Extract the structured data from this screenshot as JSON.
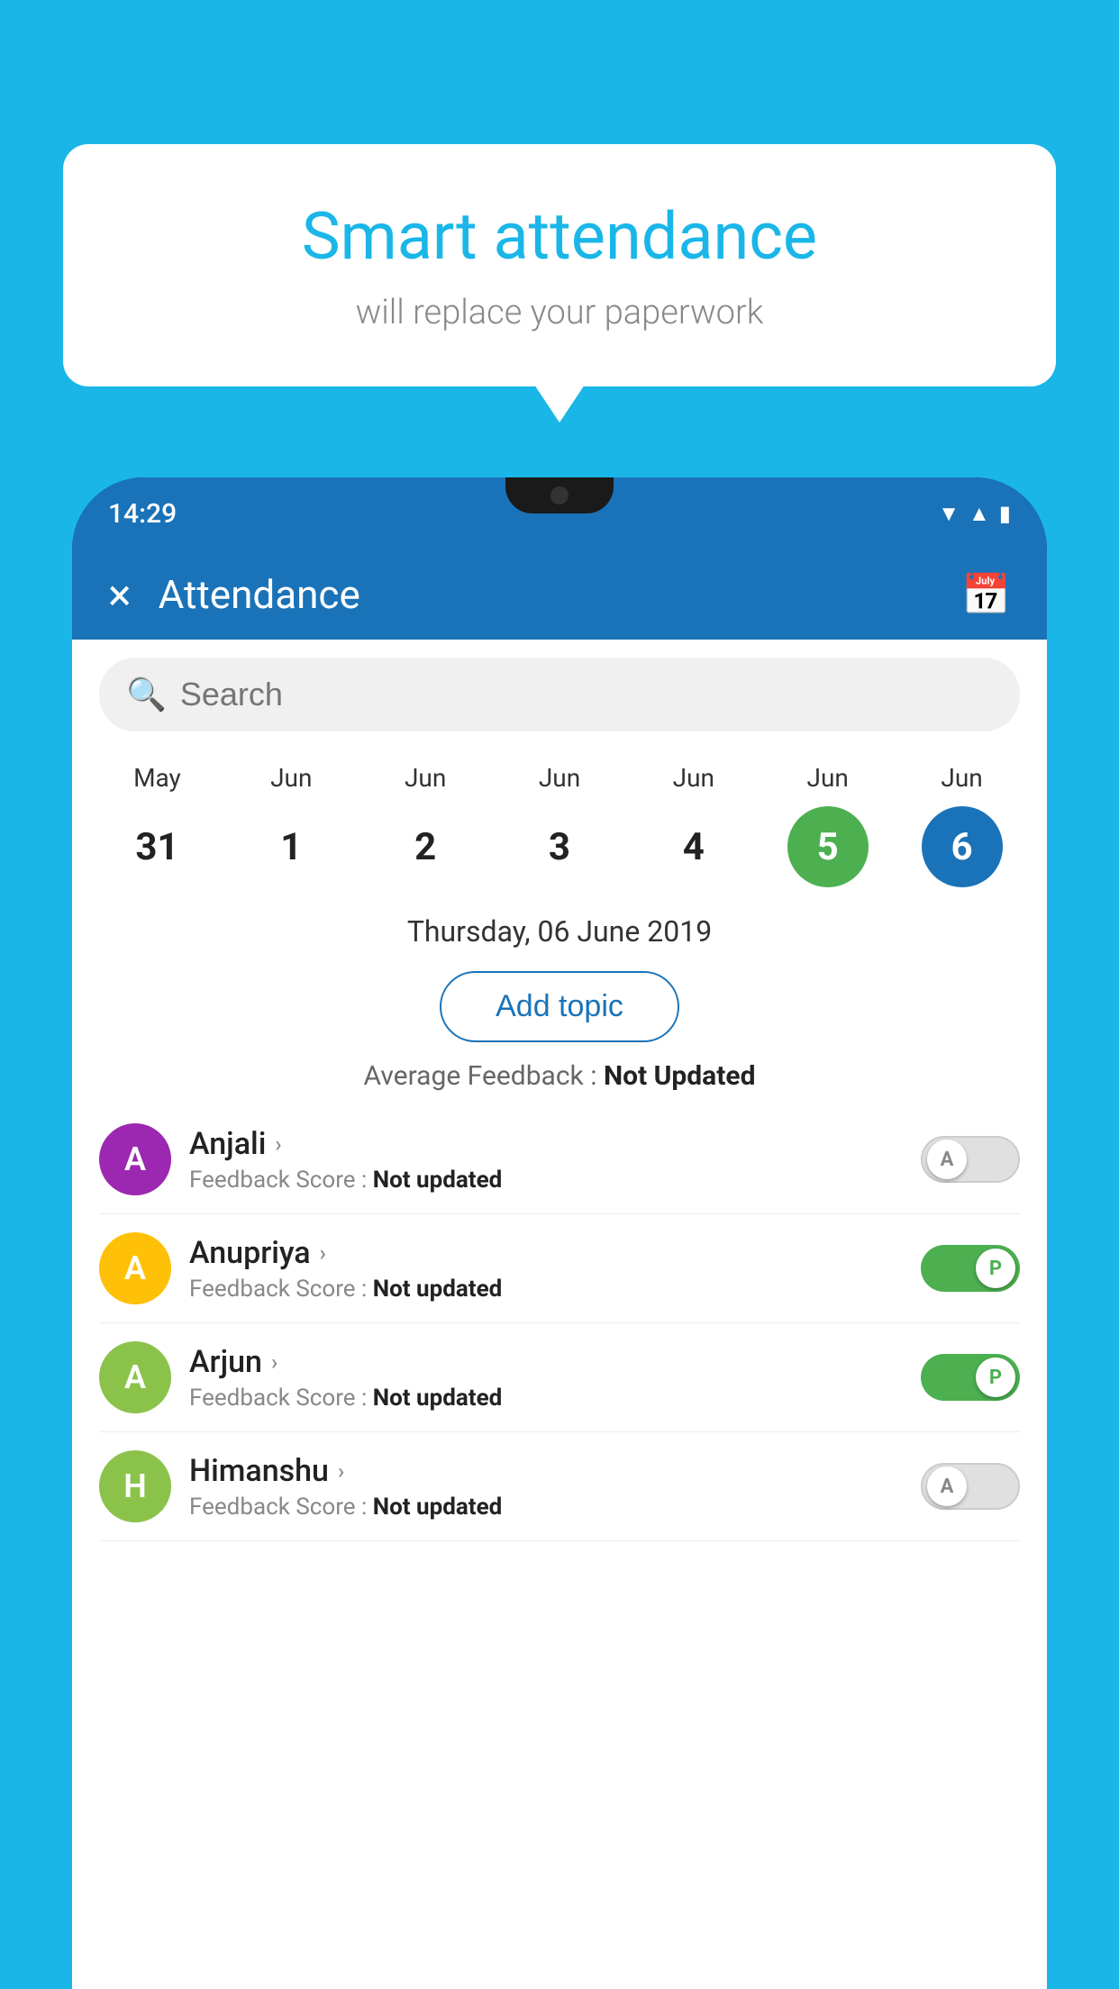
{
  "background_color": "#1ab6e8",
  "speech_bubble": {
    "title": "Smart attendance",
    "subtitle": "will replace your paperwork"
  },
  "phone": {
    "status_bar": {
      "time": "14:29"
    },
    "app_bar": {
      "title": "Attendance",
      "close_label": "×",
      "calendar_label": "📅"
    },
    "search": {
      "placeholder": "Search"
    },
    "dates": [
      {
        "month": "May",
        "day": "31"
      },
      {
        "month": "Jun",
        "day": "1"
      },
      {
        "month": "Jun",
        "day": "2"
      },
      {
        "month": "Jun",
        "day": "3"
      },
      {
        "month": "Jun",
        "day": "4"
      },
      {
        "month": "Jun",
        "day": "5",
        "state": "today"
      },
      {
        "month": "Jun",
        "day": "6",
        "state": "selected"
      }
    ],
    "selected_date_label": "Thursday, 06 June 2019",
    "add_topic_label": "Add topic",
    "avg_feedback_label": "Average Feedback :",
    "avg_feedback_value": "Not Updated",
    "students": [
      {
        "name": "Anjali",
        "avatar_letter": "A",
        "avatar_color": "#9c27b0",
        "score_label": "Feedback Score :",
        "score_value": "Not updated",
        "attendance": "absent",
        "toggle_letter": "A"
      },
      {
        "name": "Anupriya",
        "avatar_letter": "A",
        "avatar_color": "#ffc107",
        "score_label": "Feedback Score :",
        "score_value": "Not updated",
        "attendance": "present",
        "toggle_letter": "P"
      },
      {
        "name": "Arjun",
        "avatar_letter": "A",
        "avatar_color": "#8bc34a",
        "score_label": "Feedback Score :",
        "score_value": "Not updated",
        "attendance": "present",
        "toggle_letter": "P"
      },
      {
        "name": "Himanshu",
        "avatar_letter": "H",
        "avatar_color": "#8bc34a",
        "score_label": "Feedback Score :",
        "score_value": "Not updated",
        "attendance": "absent",
        "toggle_letter": "A"
      }
    ]
  }
}
